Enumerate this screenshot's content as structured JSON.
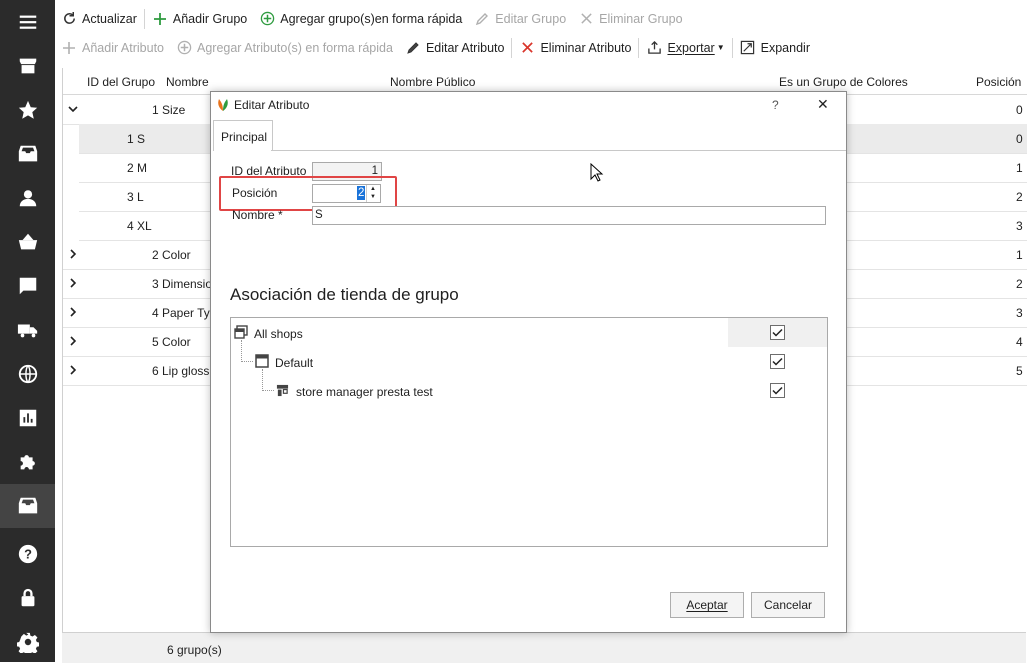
{
  "toolbar1": {
    "refresh": "Actualizar",
    "add_group": "Añadir Grupo",
    "quick_add_group": "Agregar grupo(s)en forma rápida",
    "edit_group": "Editar Grupo",
    "delete_group": "Eliminar Grupo"
  },
  "toolbar2": {
    "add_attribute": "Añadir Atributo",
    "quick_add_attribute": "Agregar Atributo(s) en forma rápida",
    "edit_attribute": "Editar Atributo",
    "delete_attribute": "Eliminar Atributo",
    "export": "Exportar",
    "expand": "Expandir"
  },
  "grid": {
    "columns": {
      "group_id": "ID del Grupo",
      "name": "Nombre",
      "public_name": "Nombre Público",
      "is_color": "Es un Grupo de Colores",
      "position": "Posición"
    },
    "rows": [
      {
        "id": "1",
        "name": "Size",
        "position": "0"
      },
      {
        "id": "1",
        "name": "S",
        "position": "0"
      },
      {
        "id": "2",
        "name": "M",
        "position": "1"
      },
      {
        "id": "3",
        "name": "L",
        "position": "2"
      },
      {
        "id": "4",
        "name": "XL",
        "position": "3"
      },
      {
        "id": "2",
        "name": "Color",
        "position": "1"
      },
      {
        "id": "3",
        "name": "Dimensio",
        "position": "2"
      },
      {
        "id": "4",
        "name": "Paper Typ",
        "position": "3"
      },
      {
        "id": "5",
        "name": "Color",
        "position": "4"
      },
      {
        "id": "6",
        "name": "Lip gloss",
        "position": "5"
      }
    ],
    "footer": "6 grupo(s)"
  },
  "dialog": {
    "title": "Editar Atributo",
    "help": "?",
    "close": "✕",
    "tab": "Principal",
    "id_label": "ID del Atributo",
    "id_value": "1",
    "position_label": "Posición",
    "position_value": "2",
    "name_label": "Nombre *",
    "name_value": "S",
    "assoc_title": "Asociación de tienda de grupo",
    "shops": [
      "All shops",
      "Default",
      "store manager presta test"
    ],
    "ok": "Aceptar",
    "cancel": "Cancelar"
  }
}
